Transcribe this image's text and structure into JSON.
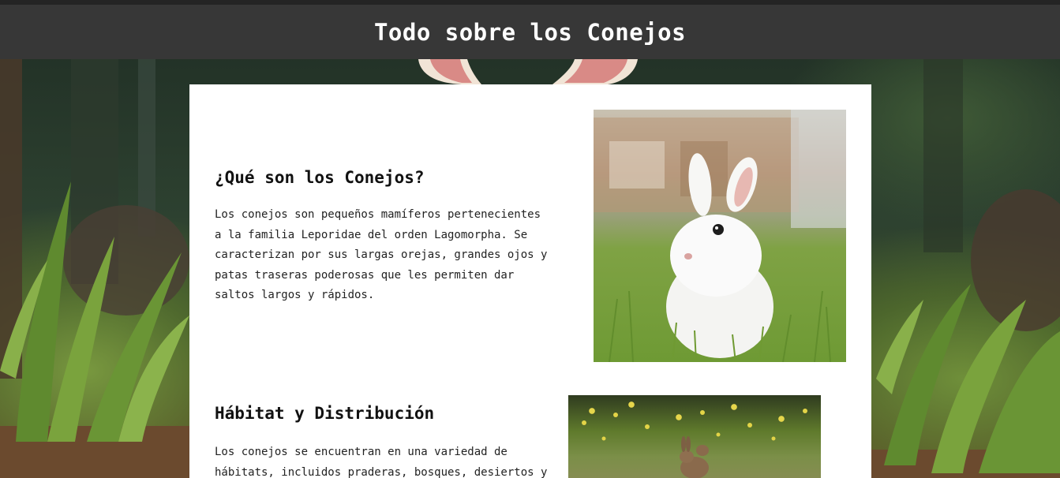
{
  "header": {
    "title": "Todo sobre los Conejos"
  },
  "sections": [
    {
      "heading": "¿Qué son los Conejos?",
      "lines": [
        "Los conejos son pequeños mamíferos pertenecientes",
        "a la familia Leporidae del orden Lagomorpha. Se",
        "caracterizan por sus largas orejas, grandes ojos y",
        "patas traseras poderosas que les permiten dar",
        "saltos largos y rápidos."
      ],
      "image": "white-bunny-photo"
    },
    {
      "heading": "Hábitat y Distribución",
      "lines": [
        "Los conejos se encuentran en una variedad de",
        "hábitats, incluidos praderas, bosques, desiertos y"
      ],
      "image": "wild-rabbit-photo"
    }
  ],
  "colors": {
    "header_bg": "#373737",
    "header_text": "#ffffff",
    "card_bg": "#ffffff",
    "text": "#222222"
  }
}
